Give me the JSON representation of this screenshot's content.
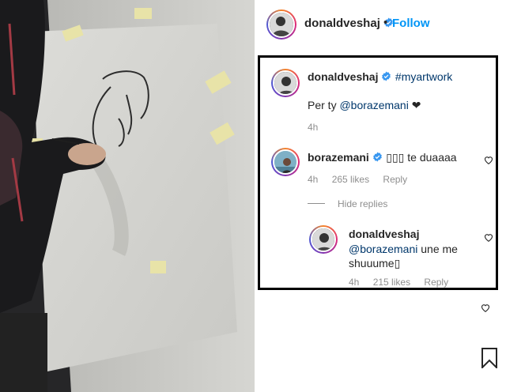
{
  "header": {
    "username": "donaldveshaj",
    "follow_label": "Follow"
  },
  "comments": {
    "caption": {
      "username": "donaldveshaj",
      "hashtag": "#myartwork",
      "text_prefix": "Per ty",
      "mention": "@borazemani",
      "text_suffix": "❤",
      "time": "4h"
    },
    "comment": {
      "username": "borazemani",
      "text": "▯▯▯ te duaaaa",
      "time": "4h",
      "likes": "265 likes",
      "reply_label": "Reply"
    },
    "hide_replies_label": "Hide replies",
    "reply": {
      "username": "donaldveshaj",
      "mention": "@borazemani",
      "text": "une me shuuume▯",
      "time": "4h",
      "likes": "215 likes",
      "reply_label": "Reply"
    }
  },
  "colors": {
    "link": "#00376b",
    "follow": "#0095f6",
    "verified": "#3897f0",
    "muted": "#8e8e8e"
  },
  "icons": {
    "verified": "verified-badge-icon",
    "heart": "heart-outline-icon",
    "bookmark": "bookmark-icon"
  }
}
